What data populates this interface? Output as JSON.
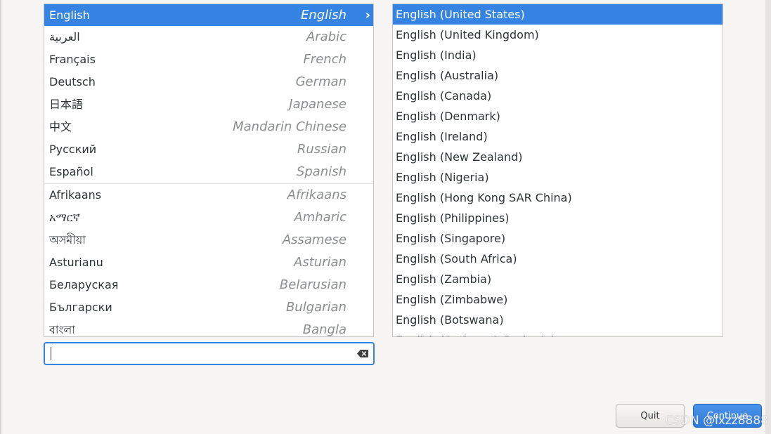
{
  "languages": [
    {
      "native": "English",
      "english": "English",
      "selected": true
    },
    {
      "native": "العربية",
      "english": "Arabic"
    },
    {
      "native": "Français",
      "english": "French"
    },
    {
      "native": "Deutsch",
      "english": "German"
    },
    {
      "native": "日本語",
      "english": "Japanese"
    },
    {
      "native": "中文",
      "english": "Mandarin Chinese"
    },
    {
      "native": "Русский",
      "english": "Russian"
    },
    {
      "native": "Español",
      "english": "Spanish"
    },
    {
      "native": "Afrikaans",
      "english": "Afrikaans"
    },
    {
      "native": "አማርኛ",
      "english": "Amharic"
    },
    {
      "native": "অসমীয়া",
      "english": "Assamese"
    },
    {
      "native": "Asturianu",
      "english": "Asturian"
    },
    {
      "native": "Беларуская",
      "english": "Belarusian"
    },
    {
      "native": "Български",
      "english": "Bulgarian"
    },
    {
      "native": "বাংলা",
      "english": "Bangla"
    }
  ],
  "search": {
    "value": "",
    "placeholder": ""
  },
  "locales": [
    {
      "label": "English (United States)",
      "selected": true
    },
    {
      "label": "English (United Kingdom)"
    },
    {
      "label": "English (India)"
    },
    {
      "label": "English (Australia)"
    },
    {
      "label": "English (Canada)"
    },
    {
      "label": "English (Denmark)"
    },
    {
      "label": "English (Ireland)"
    },
    {
      "label": "English (New Zealand)"
    },
    {
      "label": "English (Nigeria)"
    },
    {
      "label": "English (Hong Kong SAR China)"
    },
    {
      "label": "English (Philippines)"
    },
    {
      "label": "English (Singapore)"
    },
    {
      "label": "English (South Africa)"
    },
    {
      "label": "English (Zambia)"
    },
    {
      "label": "English (Zimbabwe)"
    },
    {
      "label": "English (Botswana)"
    },
    {
      "label": "English (Antigua & Barbuda)"
    }
  ],
  "buttons": {
    "quit": "Quit",
    "continue": "Continue"
  },
  "watermark": "CSDN @lxzz8888",
  "colors": {
    "accent": "#3584e4",
    "background": "#f6f5f4"
  },
  "icons": {
    "selected_arrow": "chevron-right-icon",
    "clear": "clear-text-icon"
  }
}
